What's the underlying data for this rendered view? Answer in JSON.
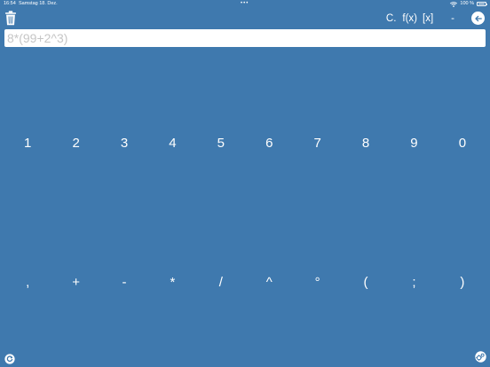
{
  "status_bar": {
    "time": "16:54",
    "date": "Samstag 18. Dez.",
    "dots": "•••",
    "battery": "100 %"
  },
  "toolbar": {
    "trash_icon": "trash-icon",
    "buttons": [
      "C.",
      "f(x)",
      "[x]",
      "-"
    ],
    "back_icon": "arrow-left-circle-icon"
  },
  "expression": {
    "value": "",
    "placeholder": "8*(99+2^3)"
  },
  "keys": {
    "digits": [
      "1",
      "2",
      "3",
      "4",
      "5",
      "6",
      "7",
      "8",
      "9",
      "0"
    ],
    "operators": [
      ",",
      "+",
      "-",
      "*",
      "/",
      "^",
      "°",
      "(",
      ";",
      ")"
    ]
  },
  "bottom": {
    "left_icon": "refresh-circle-icon",
    "right_icon": "settings-badge-icon"
  },
  "colors": {
    "background": "#3f79ae",
    "text": "#ffffff",
    "input_bg": "#ffffff",
    "placeholder": "#c6c6c6"
  }
}
